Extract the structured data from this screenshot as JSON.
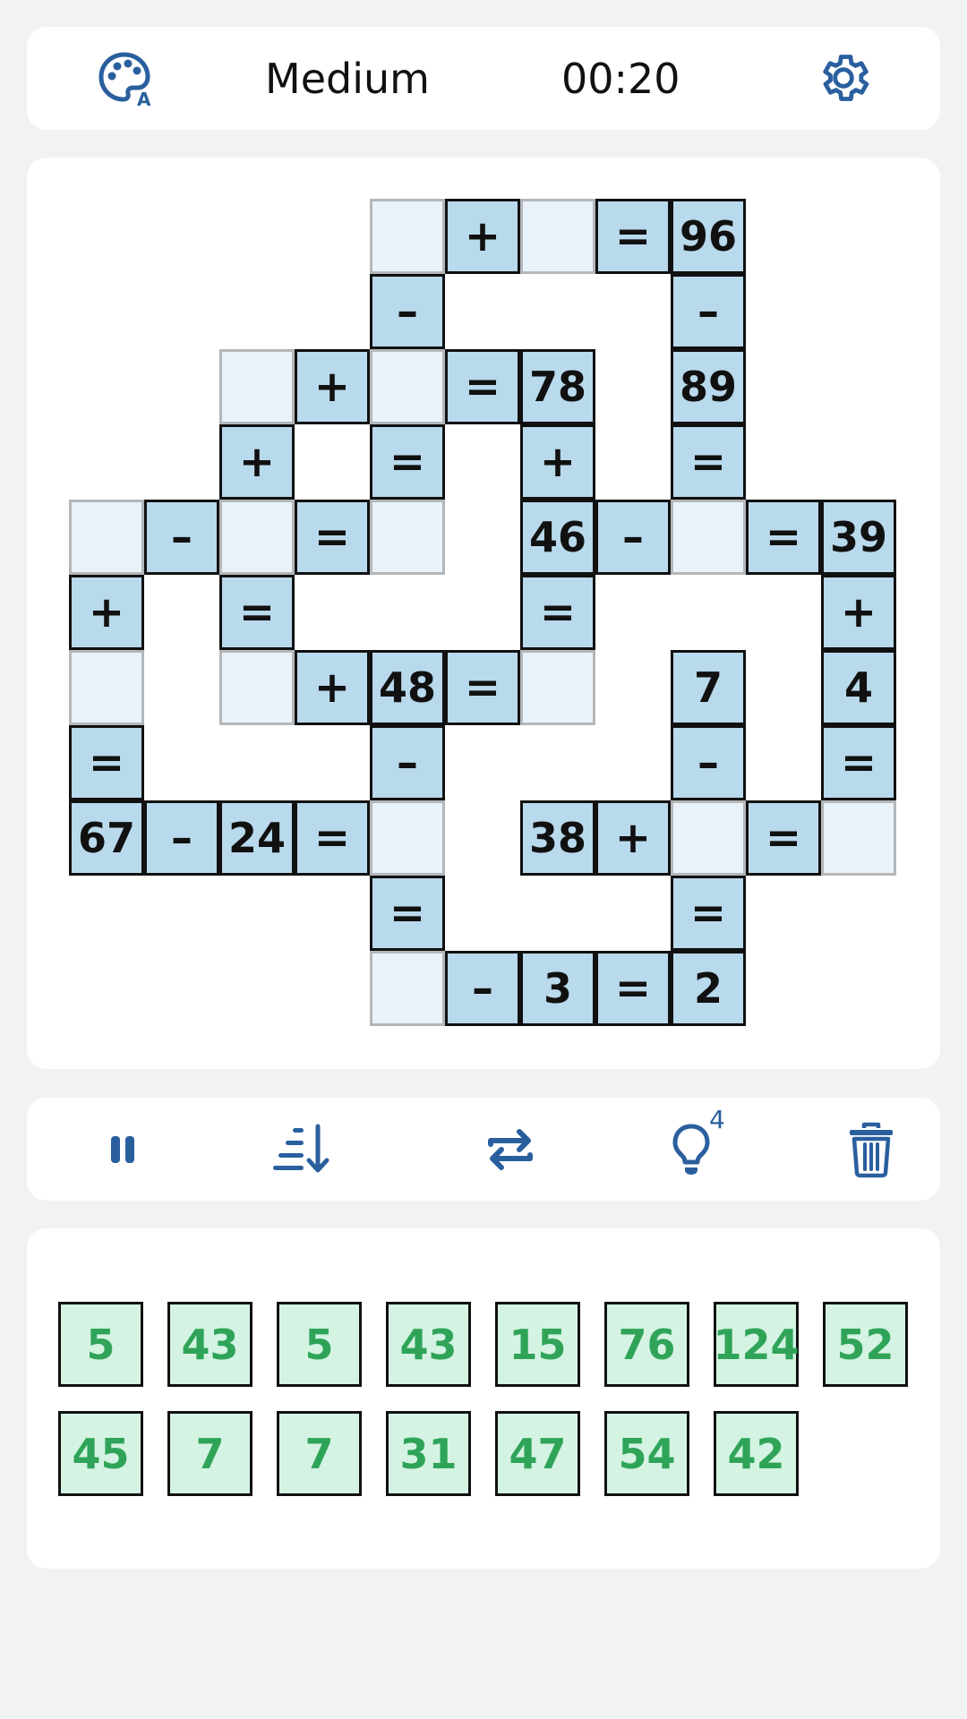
{
  "header": {
    "difficulty": "Medium",
    "timer": "00:20",
    "palette_icon": "palette-icon",
    "settings_icon": "gear-icon",
    "accent_color": "#2a5f9e"
  },
  "board": {
    "rows": [
      [
        "",
        "",
        "",
        "",
        "_",
        "+",
        "_",
        "=",
        "96",
        "",
        "",
        ""
      ],
      [
        "",
        "",
        "",
        "",
        "-",
        "",
        "",
        "",
        "-",
        "",
        "",
        ""
      ],
      [
        "",
        "",
        "_",
        "+",
        "_",
        "=",
        "78",
        "",
        "89",
        "",
        "",
        ""
      ],
      [
        "",
        "",
        "+",
        "",
        "=",
        "",
        "+",
        "",
        "=",
        "",
        "",
        ""
      ],
      [
        "_",
        "-",
        "_",
        "=",
        "_",
        "",
        "46",
        "-",
        "_",
        "=",
        "39",
        ""
      ],
      [
        "+",
        "",
        "=",
        "",
        "",
        "",
        "=",
        "",
        "",
        "",
        "+",
        ""
      ],
      [
        "_",
        "",
        "_",
        "+",
        "48",
        "=",
        "_",
        "",
        "7",
        "",
        "4",
        ""
      ],
      [
        "=",
        "",
        "",
        "",
        "-",
        "",
        "",
        "",
        "-",
        "",
        "=",
        ""
      ],
      [
        "67",
        "-",
        "24",
        "=",
        "_",
        "",
        "38",
        "+",
        "_",
        "=",
        "_",
        ""
      ],
      [
        "",
        "",
        "",
        "",
        "=",
        "",
        "",
        "",
        "=",
        "",
        "",
        ""
      ],
      [
        "",
        "",
        "",
        "",
        "_",
        "-",
        "3",
        "=",
        "2",
        "",
        "",
        ""
      ]
    ],
    "filled_color": "#b9d9ec",
    "empty_color": "#e9f2f8"
  },
  "toolbar": {
    "pause_icon": "pause-icon",
    "sort_icon": "sort-descending-icon",
    "swap_icon": "swap-icon",
    "hint_icon": "lightbulb-icon",
    "hint_count": "4",
    "delete_icon": "trash-icon"
  },
  "tray": {
    "tiles": [
      "5",
      "43",
      "5",
      "43",
      "15",
      "76",
      "124",
      "52",
      "45",
      "7",
      "7",
      "31",
      "47",
      "54",
      "42"
    ],
    "tile_color": "#d4f3e2",
    "text_color": "#2fa458"
  }
}
